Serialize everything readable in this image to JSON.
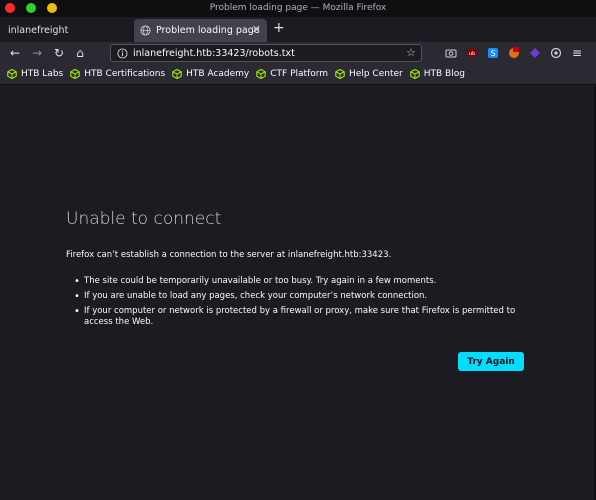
{
  "window": {
    "title": "Problem loading page — Mozilla Firefox"
  },
  "tabs": [
    {
      "label": "inlanefreight",
      "active": false
    },
    {
      "label": "Problem loading page",
      "active": true,
      "close": "✕"
    }
  ],
  "newtab": "+",
  "nav": {
    "back": "←",
    "forward": "→",
    "reload": "↻",
    "home": "⌂",
    "url": "inlanefreight.htb:33423/robots.txt",
    "star": "☆",
    "menu": "≡"
  },
  "bookmarks": [
    {
      "label": "HTB Labs"
    },
    {
      "label": "HTB Certifications"
    },
    {
      "label": "HTB Academy"
    },
    {
      "label": "CTF Platform"
    },
    {
      "label": "Help Center"
    },
    {
      "label": "HTB Blog"
    }
  ],
  "error": {
    "title": "Unable to connect",
    "description": "Firefox can’t establish a connection to the server at inlanefreight.htb:33423.",
    "items": [
      "The site could be temporarily unavailable or too busy. Try again in a few moments.",
      "If you are unable to load any pages, check your computer’s network connection.",
      "If your computer or network is protected by a firewall or proxy, make sure that Firefox is permitted to access the Web."
    ],
    "button": "Try Again"
  },
  "colors": {
    "accent": "#00ddff",
    "page_bg": "#1c1b22",
    "toolbar_bg": "#2b2a33",
    "bookmark_icon": "#9fef00"
  }
}
